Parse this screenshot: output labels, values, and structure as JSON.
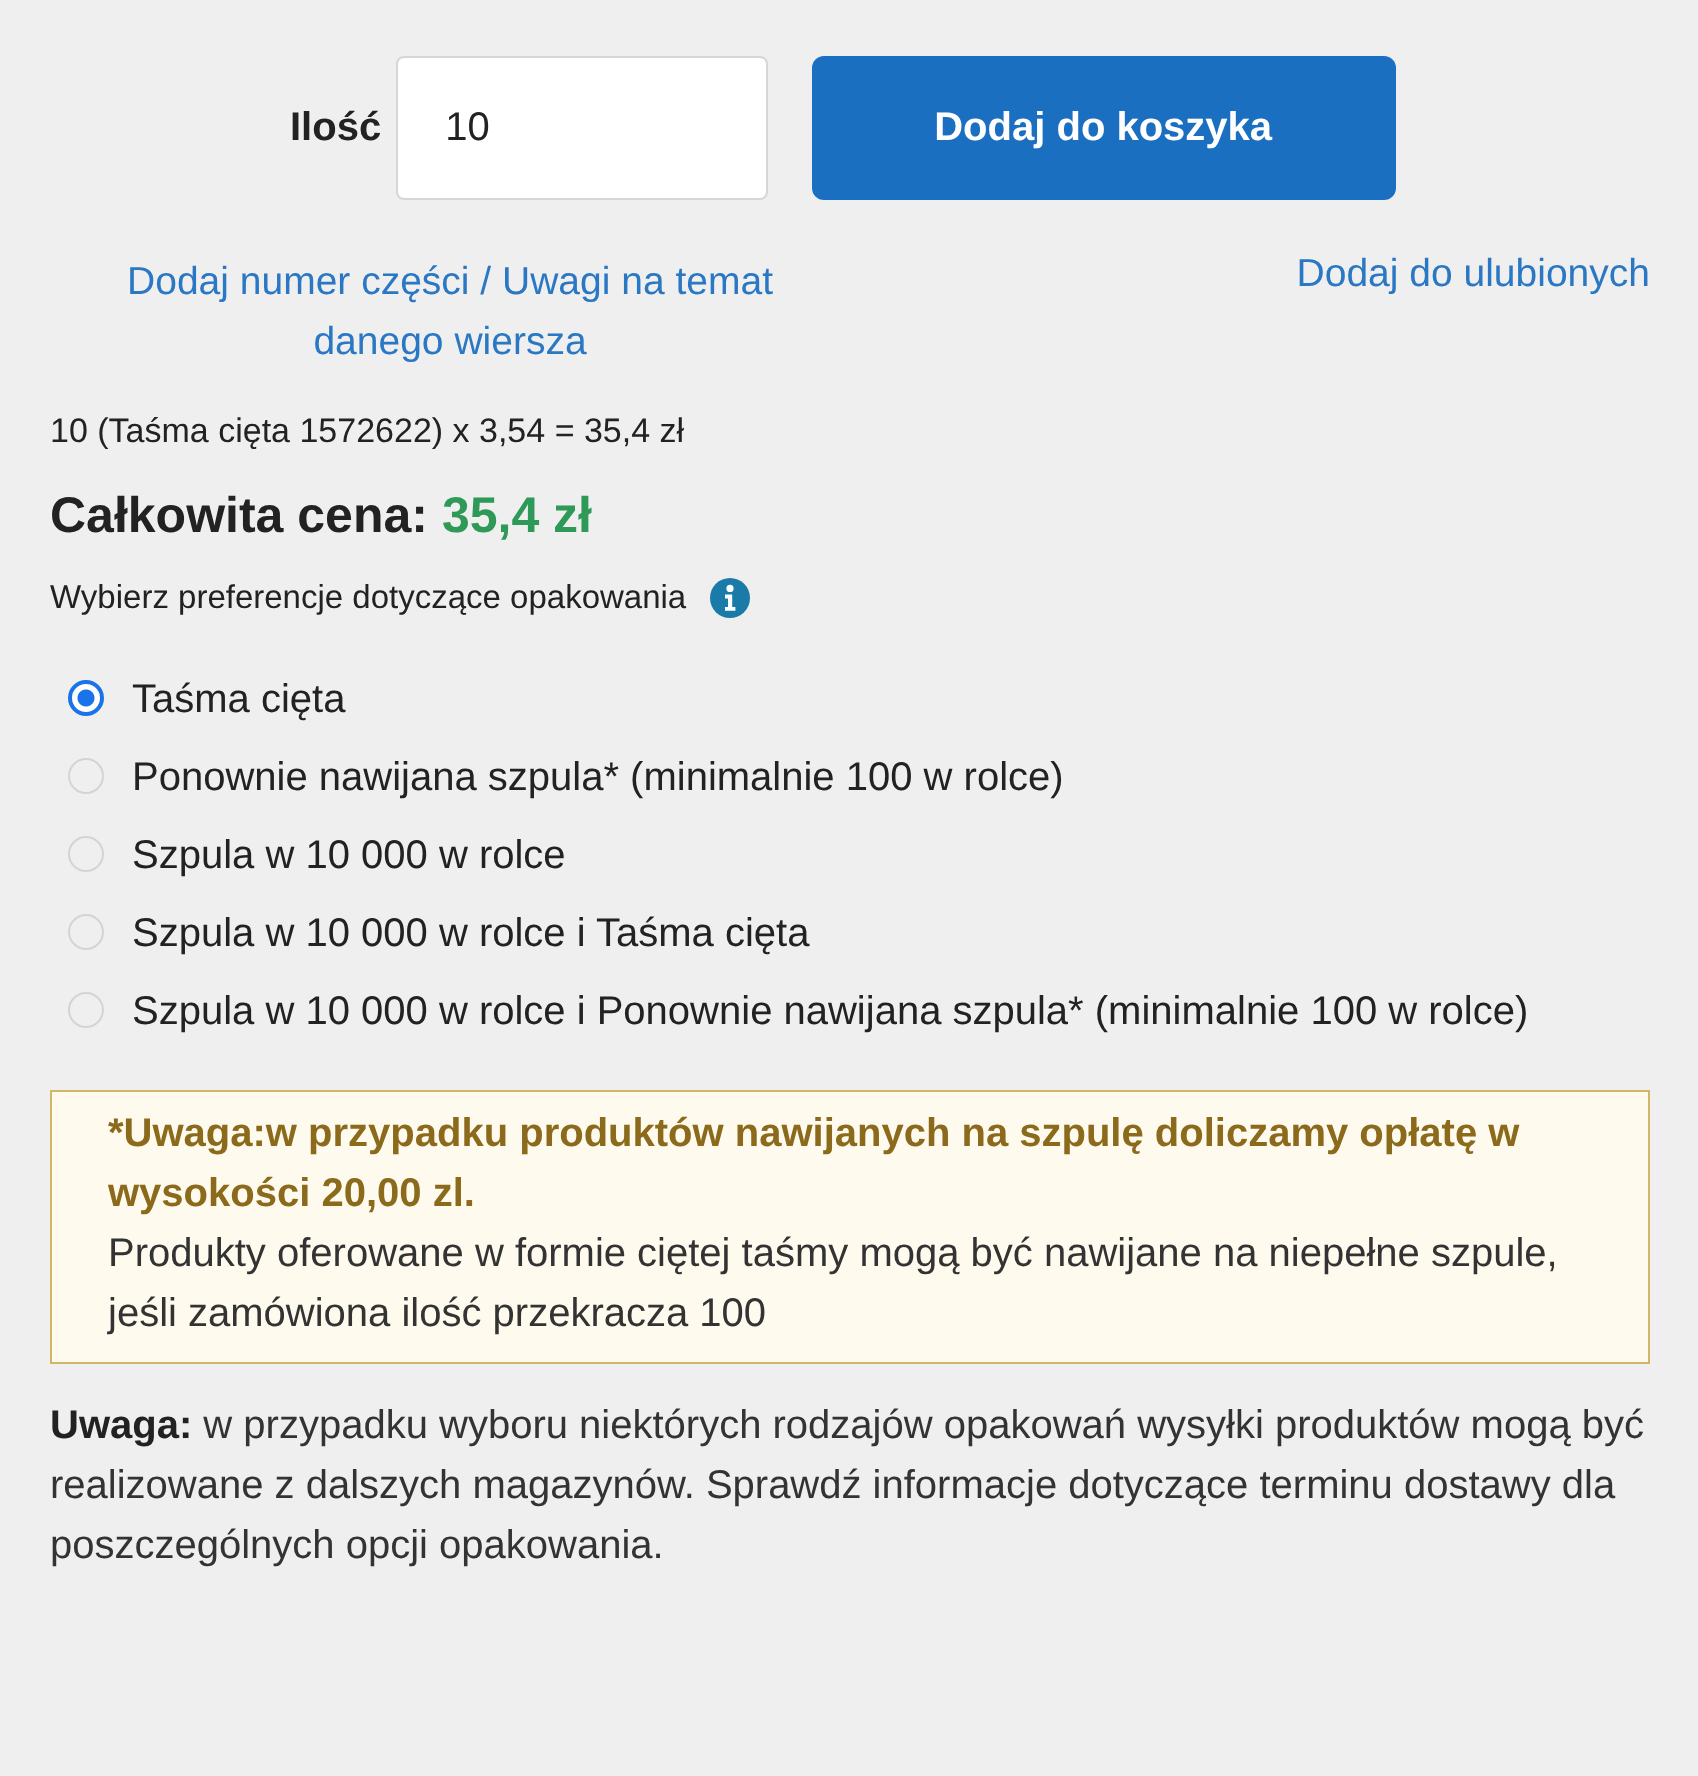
{
  "quantity": {
    "label": "Ilość",
    "value": "10"
  },
  "add_to_cart_button": "Dodaj do koszyka",
  "links": {
    "part_number": "Dodaj numer części / Uwagi na temat danego wiersza",
    "favorites": "Dodaj do ulubionych"
  },
  "calculation": "10 (Taśma cięta 1572622) x 3,54 = 35,4 zł",
  "total": {
    "label": "Całkowita cena:",
    "value": "35,4 zł"
  },
  "packaging_prompt": "Wybierz preferencje dotyczące opakowania",
  "packaging_options": [
    {
      "label": "Taśma cięta",
      "selected": true
    },
    {
      "label": "Ponownie nawijana szpula* (minimalnie 100 w rolce)",
      "selected": false
    },
    {
      "label": "Szpula w 10 000 w rolce",
      "selected": false
    },
    {
      "label": "Szpula w 10 000 w rolce i Taśma cięta",
      "selected": false
    },
    {
      "label": "Szpula w 10 000 w rolce i Ponownie nawijana szpula* (minimalnie 100 w rolce)",
      "selected": false
    }
  ],
  "reel_notice": {
    "title": "*Uwaga:w przypadku produktów nawijanych na szpulę doliczamy opłatę w wysokości 20,00 zl.",
    "body": "Produkty oferowane w formie ciętej taśmy mogą być nawijane na niepełne szpule, jeśli zamówiona ilość przekracza 100"
  },
  "shipping_note": "**Uwaga:** w przypadku wyboru niektórych rodzajów opakowań wysyłki produktów mogą być realizowane z dalszych magazynów. Sprawdź informacje dotyczące terminu dostawy dla poszczególnych opcji opakowania."
}
